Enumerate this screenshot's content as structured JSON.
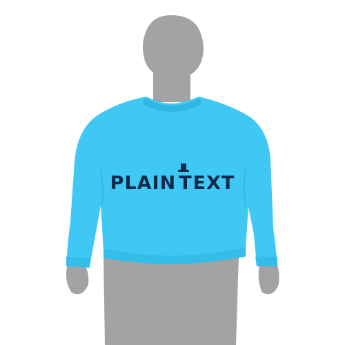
{
  "image": {
    "garment_color": "#40C8F4",
    "garment_shadow": "#2FB6E2",
    "mannequin_color": "#A3A3A3",
    "background": "#FFFFFF",
    "print_color": "#0D2A4A"
  },
  "print": {
    "word_1": "PLAIN",
    "hat_letter": "T",
    "word_2": "EXT"
  }
}
